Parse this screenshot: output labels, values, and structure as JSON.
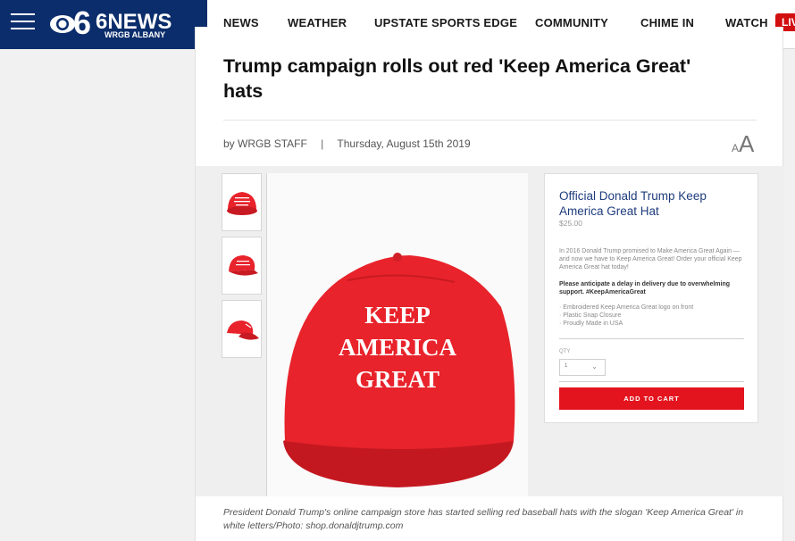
{
  "header": {
    "logo_main": "6NEWS",
    "logo_sub": "WRGB ALBANY",
    "nav": [
      "NEWS",
      "WEATHER",
      "UPSTATE SPORTS EDGE",
      "COMMUNITY",
      "CHIME IN",
      "WATCH"
    ],
    "live_badge": "LIV"
  },
  "article": {
    "headline": "Trump campaign rolls out red 'Keep America Great' hats",
    "byline_prefix": "by",
    "author": "WRGB STAFF",
    "separator": "|",
    "date": "Thursday, August 15th 2019",
    "text_size_small": "A",
    "text_size_large": "A"
  },
  "gallery": {
    "hat_text": [
      "KEEP",
      "AMERICA",
      "GREAT"
    ],
    "store": {
      "title": "Official Donald Trump Keep America Great Hat",
      "price": "$25.00",
      "description": "In 2016 Donald Trump promised to Make America Great Again — and now we have to Keep America Great! Order your official Keep America Great hat today!",
      "note": "Please anticipate a delay in delivery due to overwhelming support. #KeepAmericaGreat",
      "features": [
        "· Embroidered Keep America Great logo on front",
        "· Plastic Snap Closure",
        "· Proudly Made in USA"
      ],
      "qty_label": "QTY",
      "qty_value": "1",
      "button": "ADD TO CART"
    },
    "caption": "President Donald Trump's online campaign store has started selling red baseball hats with the slogan 'Keep America Great' in white letters/Photo: shop.donaldjtrump.com"
  },
  "colors": {
    "brand_navy": "#0b2d6b",
    "live_red": "#d20f0f",
    "hat_red": "#e8232b",
    "store_title_blue": "#1e3c7d"
  }
}
